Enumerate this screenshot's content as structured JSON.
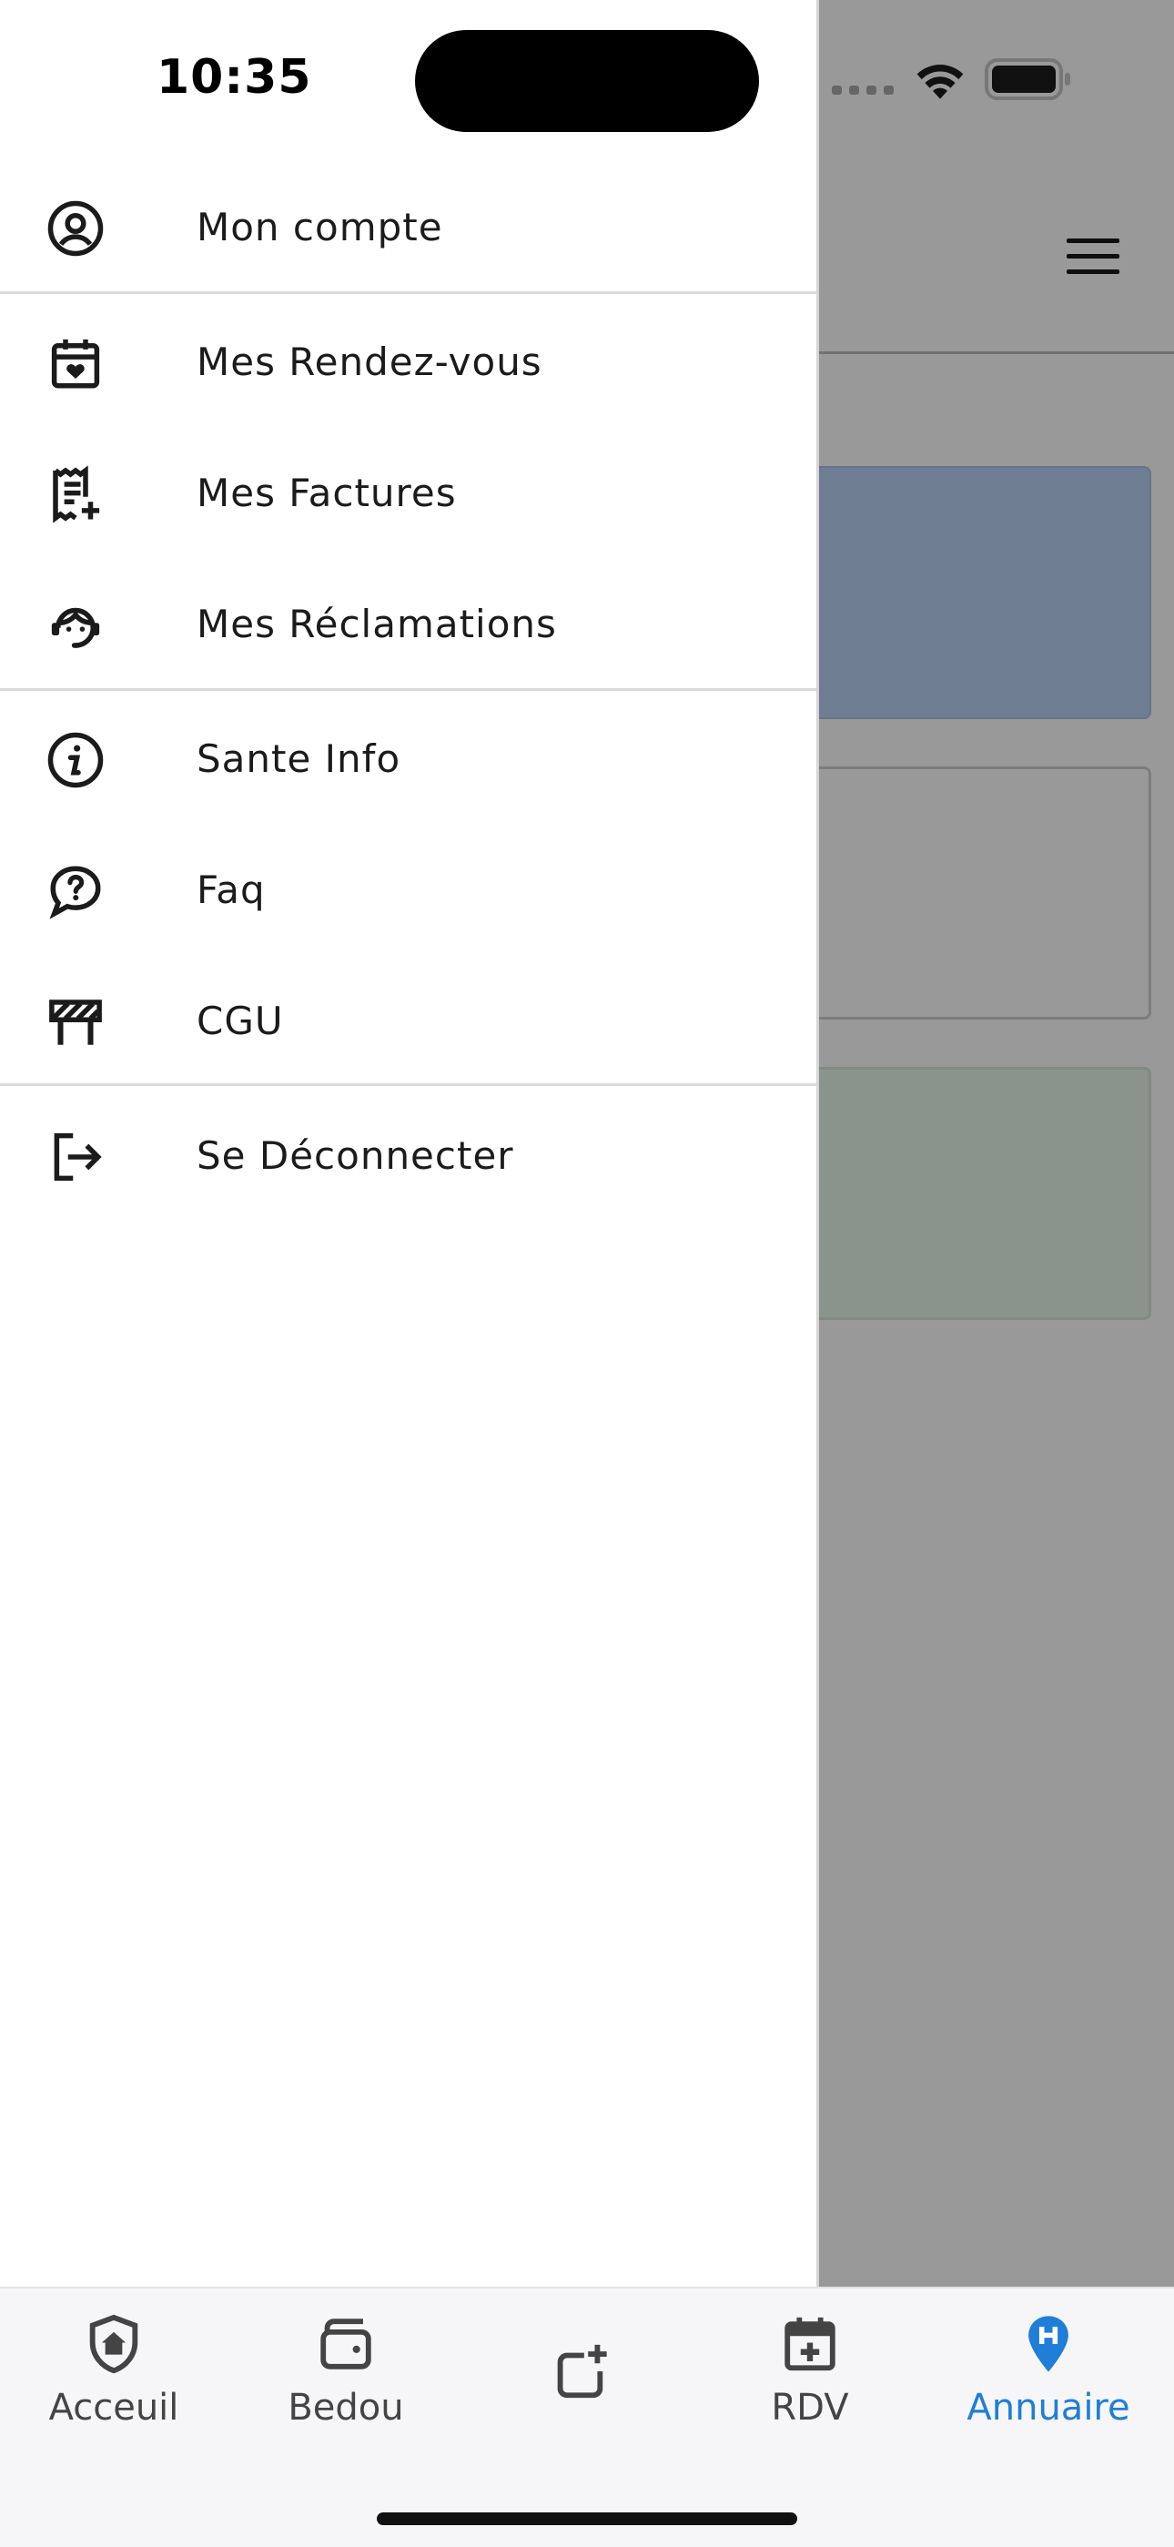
{
  "status_bar": {
    "time": "10:35"
  },
  "drawer": {
    "items": [
      {
        "label": "Mon compte",
        "icon": "user-circle-icon"
      },
      {
        "label": "Mes Rendez-vous",
        "icon": "calendar-heart-icon"
      },
      {
        "label": "Mes Factures",
        "icon": "invoice-add-icon"
      },
      {
        "label": "Mes Réclamations",
        "icon": "support-agent-icon"
      },
      {
        "label": "Sante Info",
        "icon": "info-circle-icon"
      },
      {
        "label": "Faq",
        "icon": "question-bubble-icon"
      },
      {
        "label": "CGU",
        "icon": "barrier-icon"
      },
      {
        "label": "Se Déconnecter",
        "icon": "logout-icon"
      }
    ]
  },
  "tabbar": {
    "tabs": [
      {
        "label": "Acceuil",
        "icon": "shield-home-icon",
        "active": false
      },
      {
        "label": "Bedou",
        "icon": "wallet-icon",
        "active": false
      },
      {
        "label": "",
        "icon": "add-square-icon",
        "active": false
      },
      {
        "label": "RDV",
        "icon": "calendar-add-icon",
        "active": false
      },
      {
        "label": "Annuaire",
        "icon": "hospital-pin-icon",
        "active": true
      }
    ]
  },
  "colors": {
    "accent": "#1f7ed8",
    "text": "#1b1b1b",
    "overlay": "rgba(0,0,0,0.40)"
  }
}
